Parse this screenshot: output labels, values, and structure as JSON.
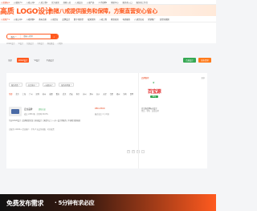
{
  "top_nav": {
    "items": [
      "八戒商标▾",
      "八戒知产▾",
      "八戒公司▾",
      "八戒工程▾",
      "官方直营",
      "商家入驻",
      "八戒会员",
      "八戒严选",
      "人才招聘▾",
      "帮助中心",
      "服务商入口",
      "服务商工作台"
    ]
  },
  "banner": {
    "title": "高质 LOGO设计",
    "slogan": "由猪八戒提供服务和保障，方案直营安心省心"
  },
  "category_nav": {
    "items": [
      "八戒知产▾",
      "八戒公司▾",
      "八戒财税▾",
      "商标注册",
      "八戒企业",
      "品牌设计",
      "数字化转型",
      "效果营销",
      "八戒工程",
      "教育培训",
      "电商服务",
      "八戒企业站",
      "营销推广",
      "宣传短视频"
    ]
  },
  "search": {
    "type_label": "服务",
    "placeholder": "请输入搜索",
    "button_icon": "search-icon",
    "hot": [
      "LOGO设计",
      "VI设计",
      "包装设计",
      "字体设计",
      "网站建设",
      "小程序"
    ]
  },
  "tabs": [
    "全部",
    "LOGO设计",
    "VI设计",
    "平面设计"
  ],
  "selected_tab_index": 1,
  "tag_buttons": {
    "green": "百城设计",
    "orange": "发布需求"
  },
  "filters": [
    "服务类型",
    "综合排序",
    "价格区间",
    "服务商等级"
  ],
  "regions": [
    "全部",
    "北京",
    "上海",
    "广州",
    "深圳",
    "杭州",
    "成都",
    "重庆",
    "武汉",
    "西安",
    "南京",
    "苏州",
    "郑州",
    "长沙",
    "天津",
    "合肥",
    "福州",
    "济南",
    "昆明"
  ],
  "listing": {
    "title": "宏业品牌",
    "badge": "实名认证",
    "meta": "成交 2456 笔 · 好评率 99.8%",
    "price": "¥80-¥300",
    "status": "最近成交 2 小时前",
    "desc": "专业LOGO设计 | 品牌视觉全案 | 原创设计 | 满意为止 | 一对一设计师服务 | 不满意全额退款",
    "desc2": "已服务 12000+ 企业客户 · 平均 3 天交付初稿 · 可开发票"
  },
  "sidebar": {
    "heading": "品牌推荐",
    "more": "更多",
    "ad_cn": "百宝源",
    "ad_en": "bby",
    "caption_line1": "百宝源品牌标志设计",
    "caption_line2": "食品 · 零售 · 连锁品牌"
  },
  "pagination": [
    "1",
    "2",
    "3",
    "›"
  ],
  "cta": {
    "main": "免费发布需求",
    "sub": "· 5分钟有求必应"
  }
}
